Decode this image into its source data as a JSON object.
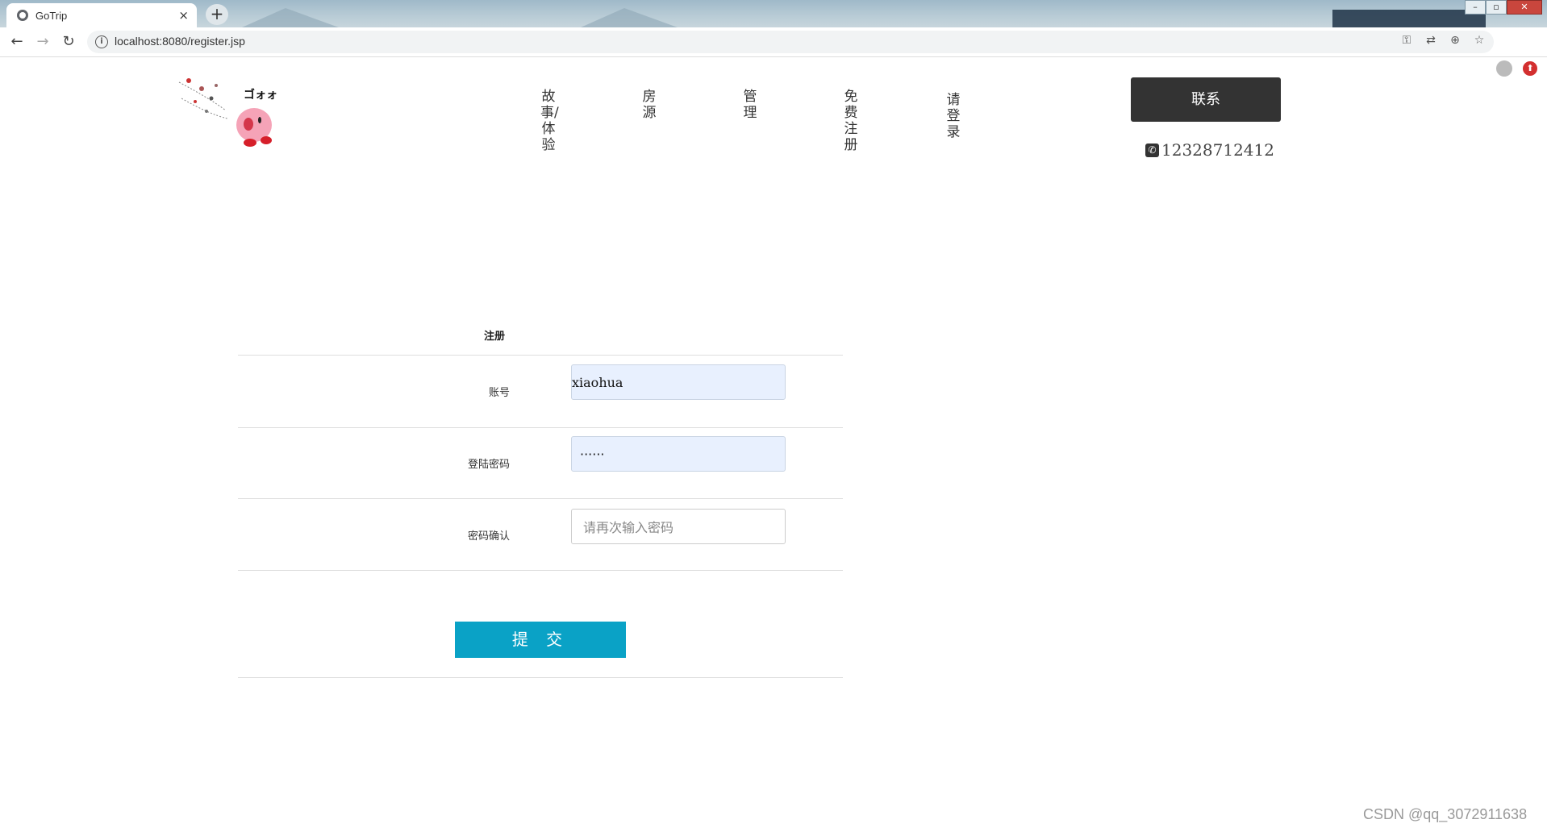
{
  "browser": {
    "tab_title": "GoTrip",
    "tab_close": "×",
    "new_tab": "+",
    "url": "localhost:8080/register.jsp",
    "window_controls": {
      "min": "–",
      "max": "▫",
      "close": "✕"
    }
  },
  "header": {
    "nav": [
      {
        "label": "故事/体验"
      },
      {
        "label": "房源"
      },
      {
        "label": "管理"
      },
      {
        "label": "免费注册"
      },
      {
        "label": "请登录"
      }
    ],
    "contact_button": "联系",
    "phone": "12328712412"
  },
  "form": {
    "title": "注册",
    "account_label": "账号",
    "account_value": "xiaohua",
    "password_label": "登陆密码",
    "password_value": "······",
    "confirm_label": "密码确认",
    "confirm_placeholder": "请再次输入密码",
    "submit": "提 交"
  },
  "watermark": "CSDN @qq_3072911638",
  "colors": {
    "submit_bg": "#0aa2c6",
    "contact_bg": "#333333",
    "autofill_bg": "#e8f0fe"
  }
}
